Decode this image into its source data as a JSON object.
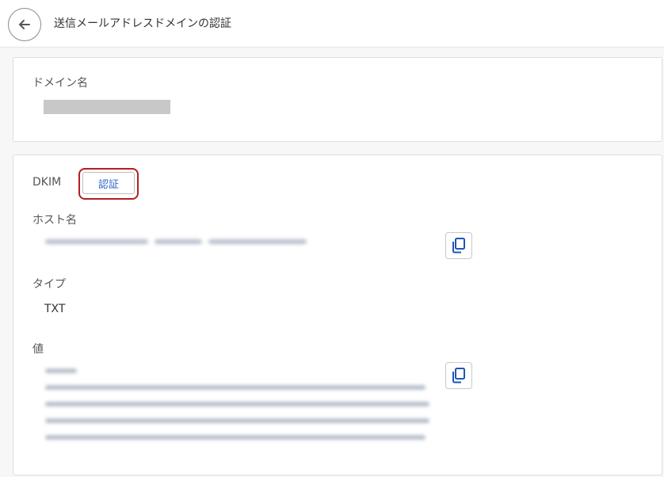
{
  "header": {
    "back_icon": "arrow-left-icon",
    "title": "送信メールアドレスドメインの認証"
  },
  "domain_card": {
    "label": "ドメイン名"
  },
  "dkim_card": {
    "label": "DKIM",
    "verify_button": "認証",
    "highlight_color": "#b51c24",
    "host": {
      "label": "ホスト名",
      "copy_icon": "copy-icon"
    },
    "type": {
      "label": "タイプ",
      "value": "TXT"
    },
    "value": {
      "label": "値",
      "copy_icon": "copy-icon"
    }
  }
}
